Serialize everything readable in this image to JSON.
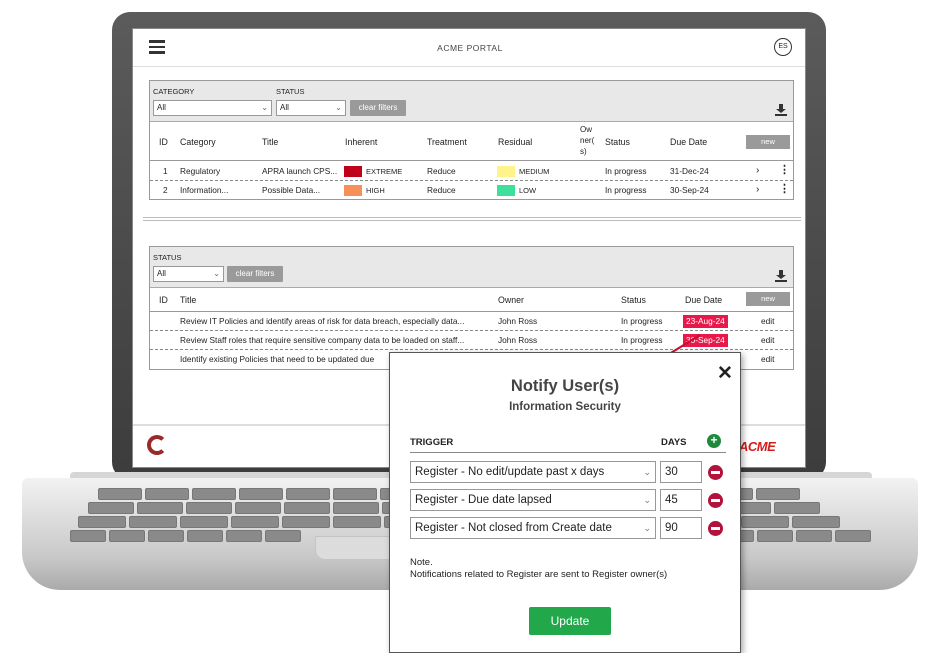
{
  "app": {
    "title": "ACME PORTAL",
    "user_initials": "ES"
  },
  "top_panel": {
    "category_label": "CATEGORY",
    "category_value": "All",
    "status_label": "STATUS",
    "status_value": "All",
    "clear_filters": "clear filters",
    "columns": [
      "ID",
      "Category",
      "Title",
      "Inherent",
      "Treatment",
      "Residual",
      "Ow ner( s)",
      "Status",
      "Due Date"
    ],
    "new_label": "new",
    "rows": [
      {
        "id": "1",
        "category": "Regulatory",
        "title": "APRA launch CPS...",
        "inherent": "EXTREME",
        "inherent_color": "#c0001a",
        "treatment": "Reduce",
        "residual": "MEDIUM",
        "residual_color": "#fff38a",
        "status": "In progress",
        "due": "31-Dec-24"
      },
      {
        "id": "2",
        "category": "Information...",
        "title": "Possible Data...",
        "inherent": "HIGH",
        "inherent_color": "#f59058",
        "treatment": "Reduce",
        "residual": "LOW",
        "residual_color": "#3de09a",
        "status": "In progress",
        "due": "30-Sep-24"
      }
    ]
  },
  "bottom_panel": {
    "status_label": "STATUS",
    "status_value": "All",
    "clear_filters": "clear filters",
    "columns": [
      "ID",
      "Title",
      "Owner",
      "Status",
      "Due Date"
    ],
    "new_label": "new",
    "rows": [
      {
        "title": "Review IT Policies and identify areas of risk for data breach, especially data...",
        "owner": "John Ross",
        "status": "In progress",
        "due": "23-Aug-24",
        "action": "edit"
      },
      {
        "title": "Review Staff roles that require sensitive company data to be loaded on staff...",
        "owner": "John Ross",
        "status": "In progress",
        "due": "30-Sep-24",
        "action": "edit"
      },
      {
        "title": "Identify existing Policies that need to be updated due",
        "owner": "",
        "status": "",
        "due": "",
        "action": "edit"
      }
    ],
    "due_badge_color": "#e8194a"
  },
  "footer": {
    "brand": "ACME"
  },
  "modal": {
    "title": "Notify User(s)",
    "subtitle": "Information Security",
    "trigger_header": "TRIGGER",
    "days_header": "DAYS",
    "triggers": [
      {
        "trigger": "Register - No edit/update past x days",
        "days": "30"
      },
      {
        "trigger": "Register - Due date lapsed",
        "days": "45"
      },
      {
        "trigger": "Register - Not closed from Create date",
        "days": "90"
      }
    ],
    "note_title": "Note.",
    "note_text": "Notifications related to Register are sent to Register owner(s)",
    "update_label": "Update",
    "accent_green": "#22a84a",
    "remove_color": "#b3123a"
  },
  "icons": [
    "menu-icon",
    "download-icon",
    "chevron-right-icon",
    "kebab-menu-icon",
    "close-icon",
    "add-icon",
    "remove-icon",
    "chevron-down-icon"
  ]
}
